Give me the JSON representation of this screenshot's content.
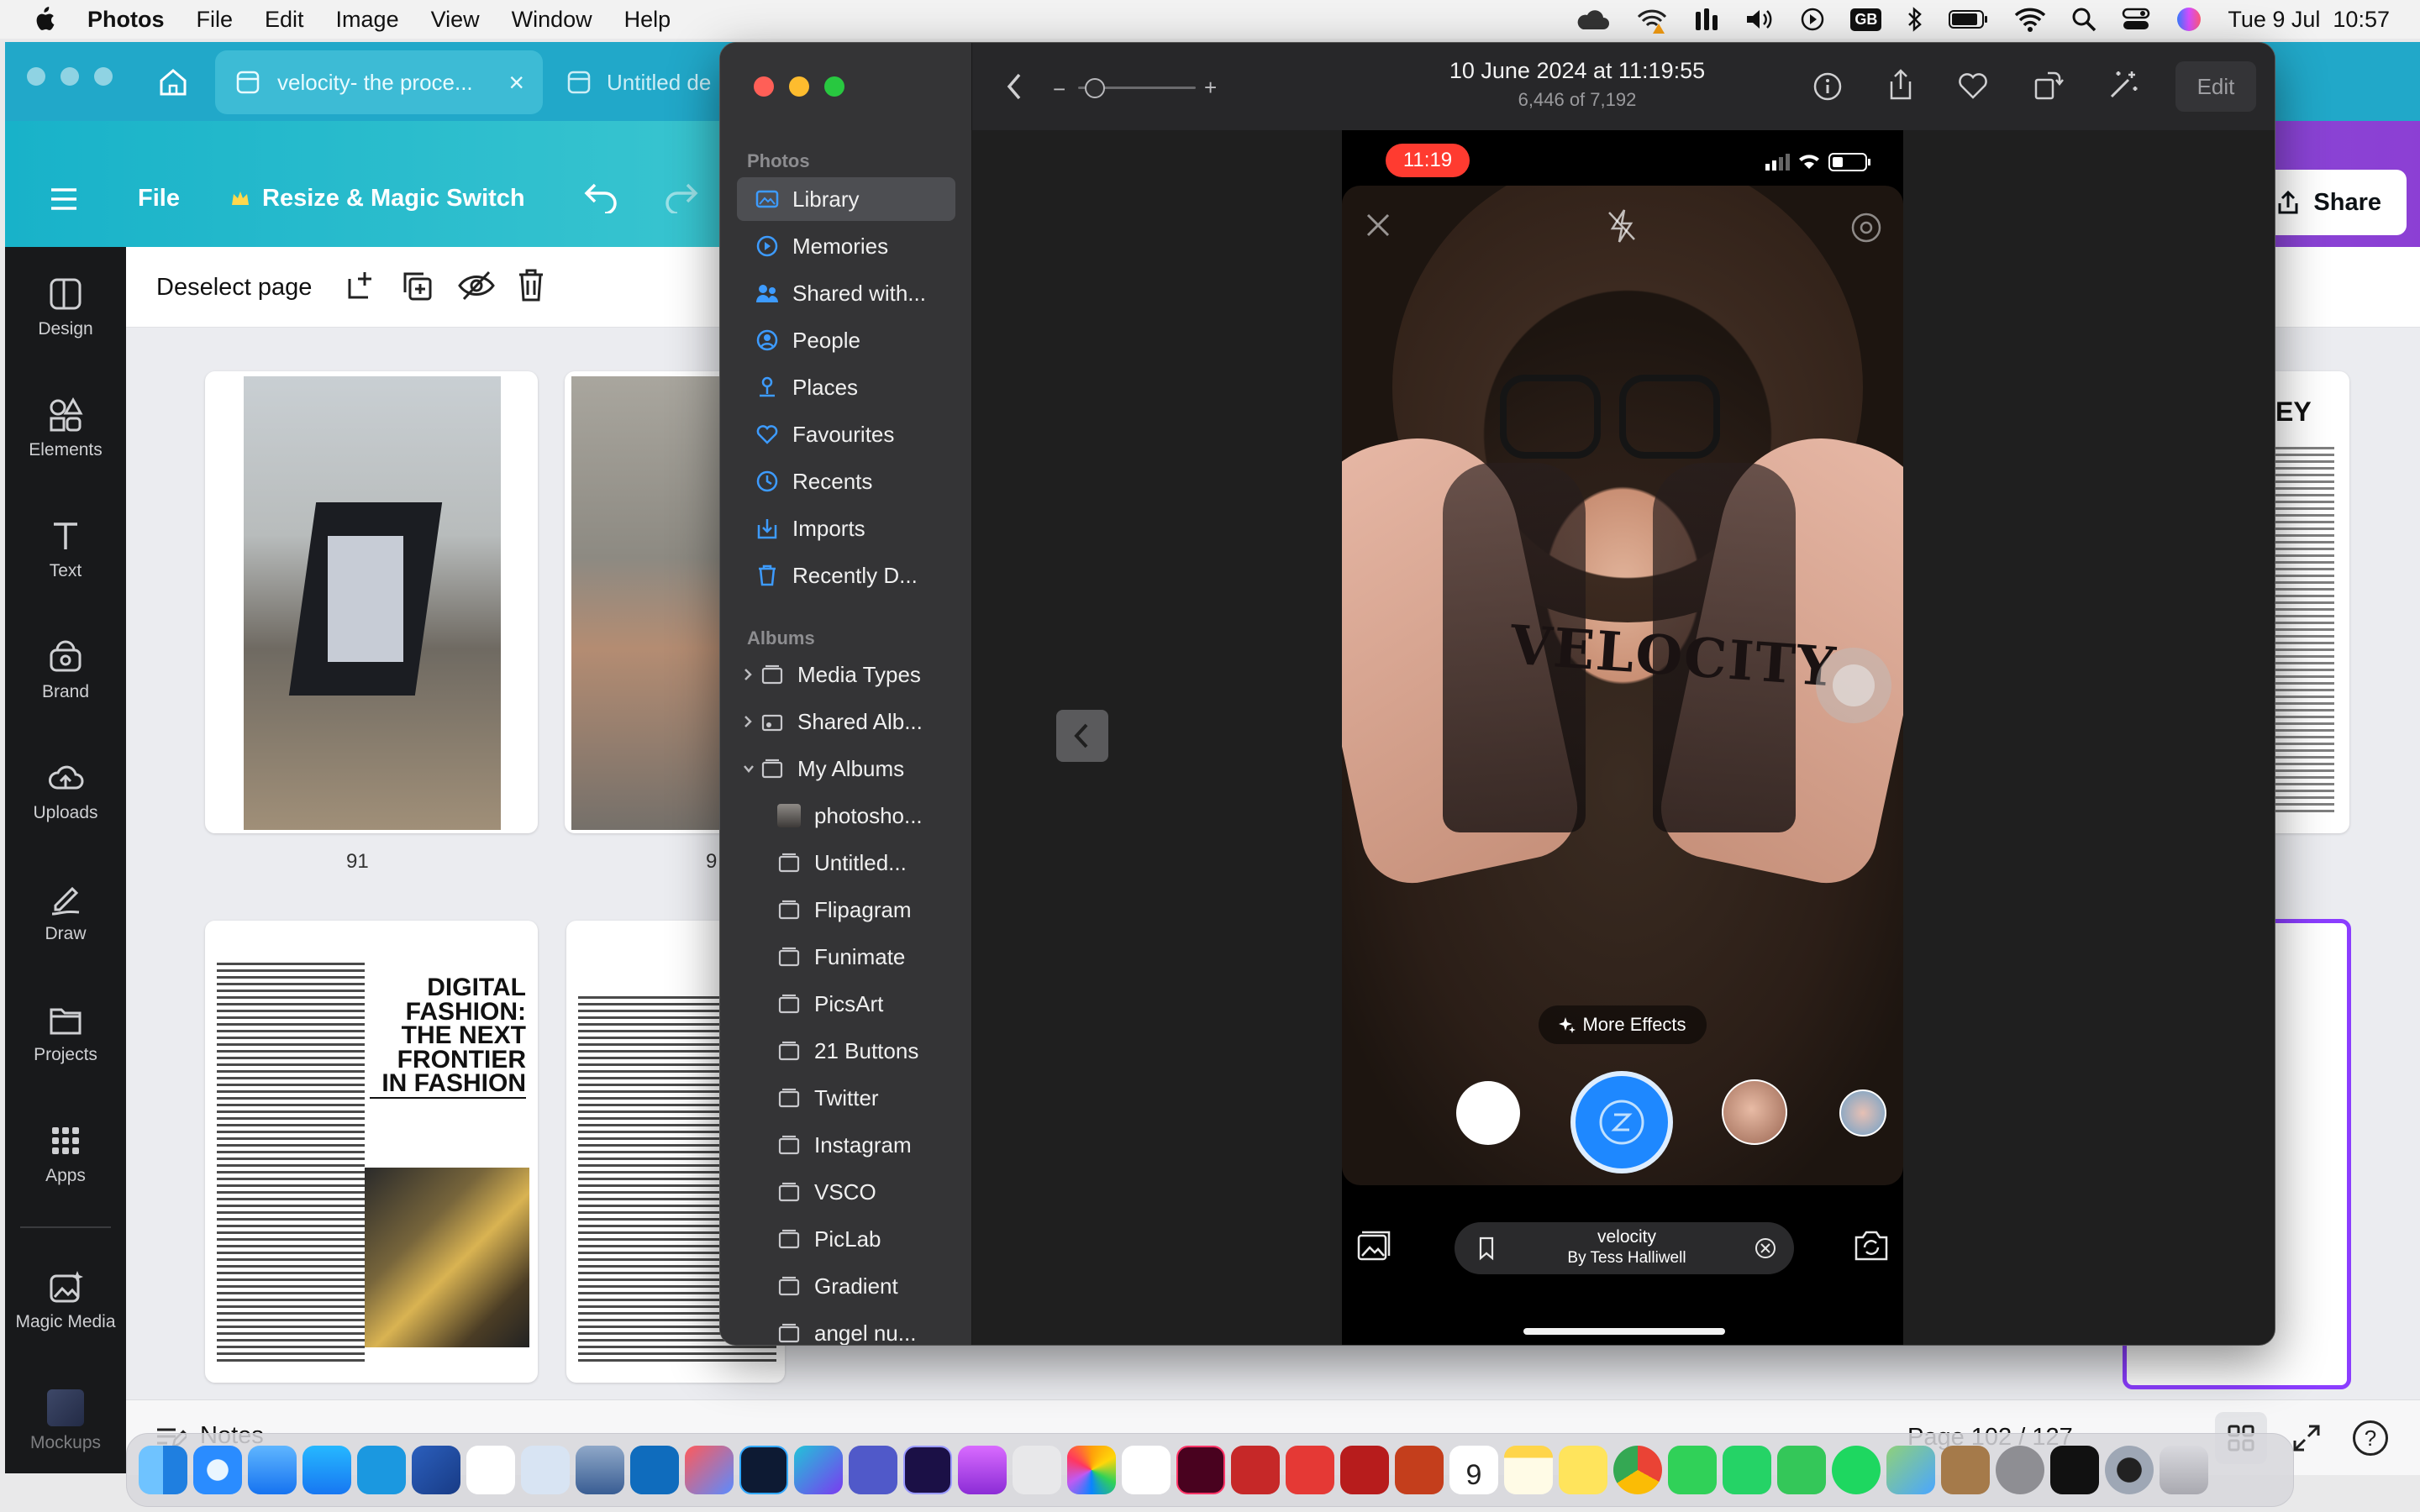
{
  "menubar": {
    "app_name": "Photos",
    "menus": [
      "File",
      "Edit",
      "Image",
      "View",
      "Window",
      "Help"
    ],
    "status_badge": "GB",
    "clock": "Tue 9 Jul  10:57"
  },
  "canva": {
    "tabs": [
      {
        "label": "velocity- the proce...",
        "close": "×"
      },
      {
        "label": "Untitled de"
      }
    ],
    "file_label": "File",
    "resize_label": "Resize & Magic Switch",
    "share_label": "Share",
    "deselect_label": "Deselect page",
    "sidebar": [
      "Design",
      "Elements",
      "Text",
      "Brand",
      "Uploads",
      "Draw",
      "Projects",
      "Apps",
      "Magic Media",
      "Mockups"
    ],
    "pages": [
      {
        "number": "91"
      },
      {
        "number": "9"
      }
    ],
    "article_title": "DIGITAL FASHION: THE NEXT FRONTIER IN FASHION",
    "right_page_header": "EY",
    "notes_label": "Notes",
    "page_indicator": "Page 102 / 127",
    "help_label": "?"
  },
  "photos": {
    "date": "10 June 2024 at 11:19:55",
    "count": "6,446 of 7,192",
    "edit_label": "Edit",
    "sections": {
      "photos": "Photos",
      "albums": "Albums"
    },
    "library_items": [
      "Library",
      "Memories",
      "Shared with...",
      "People",
      "Places",
      "Favourites",
      "Recents",
      "Imports",
      "Recently D..."
    ],
    "album_groups": [
      "Media Types",
      "Shared Alb...",
      "My Albums"
    ],
    "albums": [
      "photosho...",
      "Untitled...",
      "Flipagram",
      "Funimate",
      "PicsArt",
      "21 Buttons",
      "Twitter",
      "Instagram",
      "VSCO",
      "PicLab",
      "Gradient",
      "angel nu..."
    ]
  },
  "phone": {
    "time": "11:19",
    "overlay_text": "VELOCITY",
    "more_effects": "More Effects",
    "effect_name": "velocity",
    "effect_author": "By Tess Halliwell"
  },
  "colors": {
    "canva_teal": "#21a8c9",
    "canva_purple": "#8c3fd4",
    "photos_sidebar": "#343436",
    "selection_blue": "#1e88ff",
    "record_red": "#ff3b30"
  },
  "dock_icons": [
    "finder-icon",
    "safari-icon",
    "mail-icon",
    "app-store-icon",
    "prime-video-icon",
    "word-icon",
    "tasks-icon",
    "print-icon",
    "preview-icon",
    "outlook-icon",
    "photo-editor-icon",
    "photoshop-icon",
    "canva-icon",
    "teams-icon",
    "after-effects-icon",
    "podcasts-icon",
    "creative-cloud-icon",
    "photos-icon",
    "reminders-icon",
    "indesign-icon",
    "photo-booth-icon",
    "airmail-icon",
    "dictionary-icon",
    "powerpoint-icon",
    "calendar-icon",
    "notes-icon",
    "stickies-icon",
    "chrome-icon",
    "facetime-icon",
    "whatsapp-icon",
    "messages-icon",
    "spotify-icon",
    "maps-icon",
    "archive-icon",
    "system-settings-icon",
    "capcut-icon",
    "quicktime-icon",
    "trash-icon"
  ],
  "dock_calendar_day": "9"
}
